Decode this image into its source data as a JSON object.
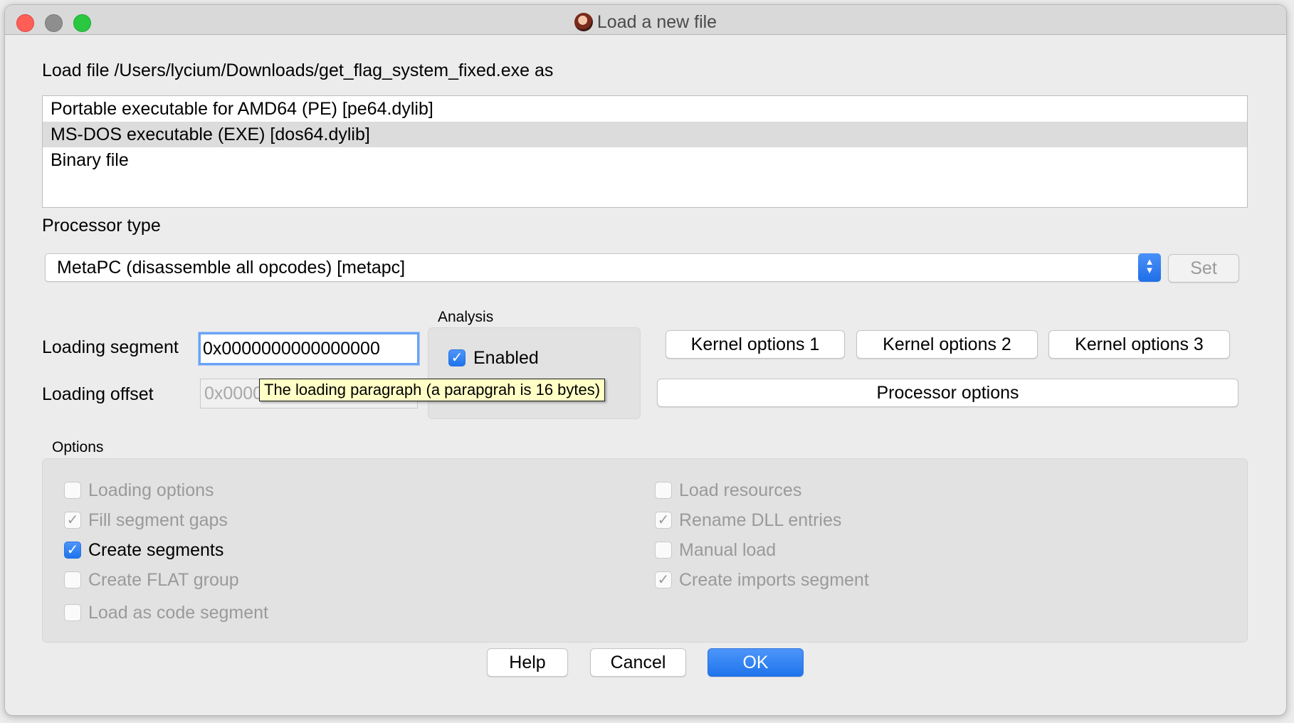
{
  "window": {
    "title": "Load a new file",
    "load_file_label": "Load file /Users/lycium/Downloads/get_flag_system_fixed.exe as",
    "loaders": [
      {
        "label": "Portable executable for AMD64 (PE) [pe64.dylib]",
        "selected": false
      },
      {
        "label": "MS-DOS executable (EXE) [dos64.dylib]",
        "selected": true
      },
      {
        "label": "Binary file",
        "selected": false
      }
    ],
    "processor_type_label": "Processor type",
    "processor_value": "MetaPC (disassemble all opcodes) [metapc]",
    "set_button": "Set"
  },
  "segment": {
    "loading_segment_label": "Loading segment",
    "loading_segment_value": "0x0000000000000000",
    "loading_offset_label": "Loading offset",
    "loading_offset_value": "0x0000000000000000",
    "tooltip": "The loading paragraph (a parapgrah is 16 bytes)"
  },
  "analysis": {
    "title": "Analysis",
    "enabled_label": "Enabled",
    "enabled_checked": true
  },
  "kernel": {
    "options1": "Kernel options 1",
    "options2": "Kernel options 2",
    "options3": "Kernel options 3",
    "processor_options": "Processor options"
  },
  "options": {
    "title": "Options",
    "left": [
      {
        "label": "Loading options",
        "checked": false,
        "enabled": false
      },
      {
        "label": "Fill segment gaps",
        "checked": true,
        "enabled": false
      },
      {
        "label": "Create segments",
        "checked": true,
        "enabled": true
      },
      {
        "label": "Create FLAT group",
        "checked": false,
        "enabled": false
      },
      {
        "label": "Load as code segment",
        "checked": false,
        "enabled": false
      }
    ],
    "right": [
      {
        "label": "Load resources",
        "checked": false,
        "enabled": false
      },
      {
        "label": "Rename DLL entries",
        "checked": true,
        "enabled": false
      },
      {
        "label": "Manual load",
        "checked": false,
        "enabled": false
      },
      {
        "label": "Create imports segment",
        "checked": true,
        "enabled": false
      }
    ]
  },
  "buttons": {
    "help": "Help",
    "cancel": "Cancel",
    "ok": "OK"
  },
  "icons": {
    "check": "✓",
    "updown": "⌃⌄"
  },
  "colors": {
    "accent": "#2a7bf0",
    "tooltip_bg": "#ffffc6"
  }
}
